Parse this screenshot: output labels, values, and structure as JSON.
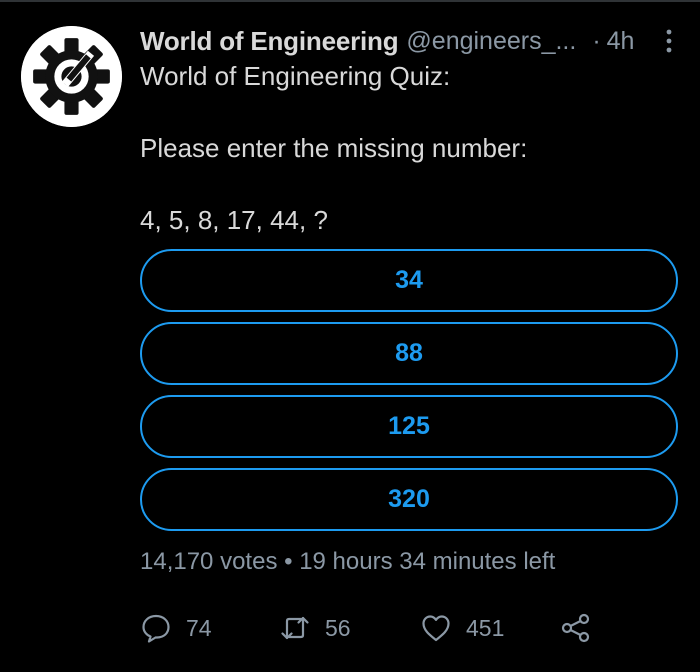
{
  "tweet": {
    "author_name": "World of Engineering",
    "handle": "@engineers_...",
    "separator": "·",
    "time": "4h",
    "text": {
      "line1": "World of Engineering Quiz:",
      "line2": "Please enter the missing number:",
      "line3": "4, 5, 8, 17, 44, ?"
    }
  },
  "poll": {
    "options": [
      {
        "label": "34"
      },
      {
        "label": "88"
      },
      {
        "label": "125"
      },
      {
        "label": "320"
      }
    ],
    "votes": "14,170 votes",
    "meta_separator": "•",
    "time_left": "19 hours 34 minutes left"
  },
  "actions": {
    "replies": "74",
    "retweets": "56",
    "likes": "451"
  },
  "colors": {
    "background": "#000000",
    "text": "#d9d9d9",
    "muted": "#8b98a5",
    "accent": "#1d9bf0"
  },
  "icons": {
    "avatar": "gear-wrench-logo",
    "more": "more-vertical-icon",
    "reply": "reply-icon",
    "retweet": "retweet-icon",
    "like": "heart-icon",
    "share": "share-icon"
  }
}
